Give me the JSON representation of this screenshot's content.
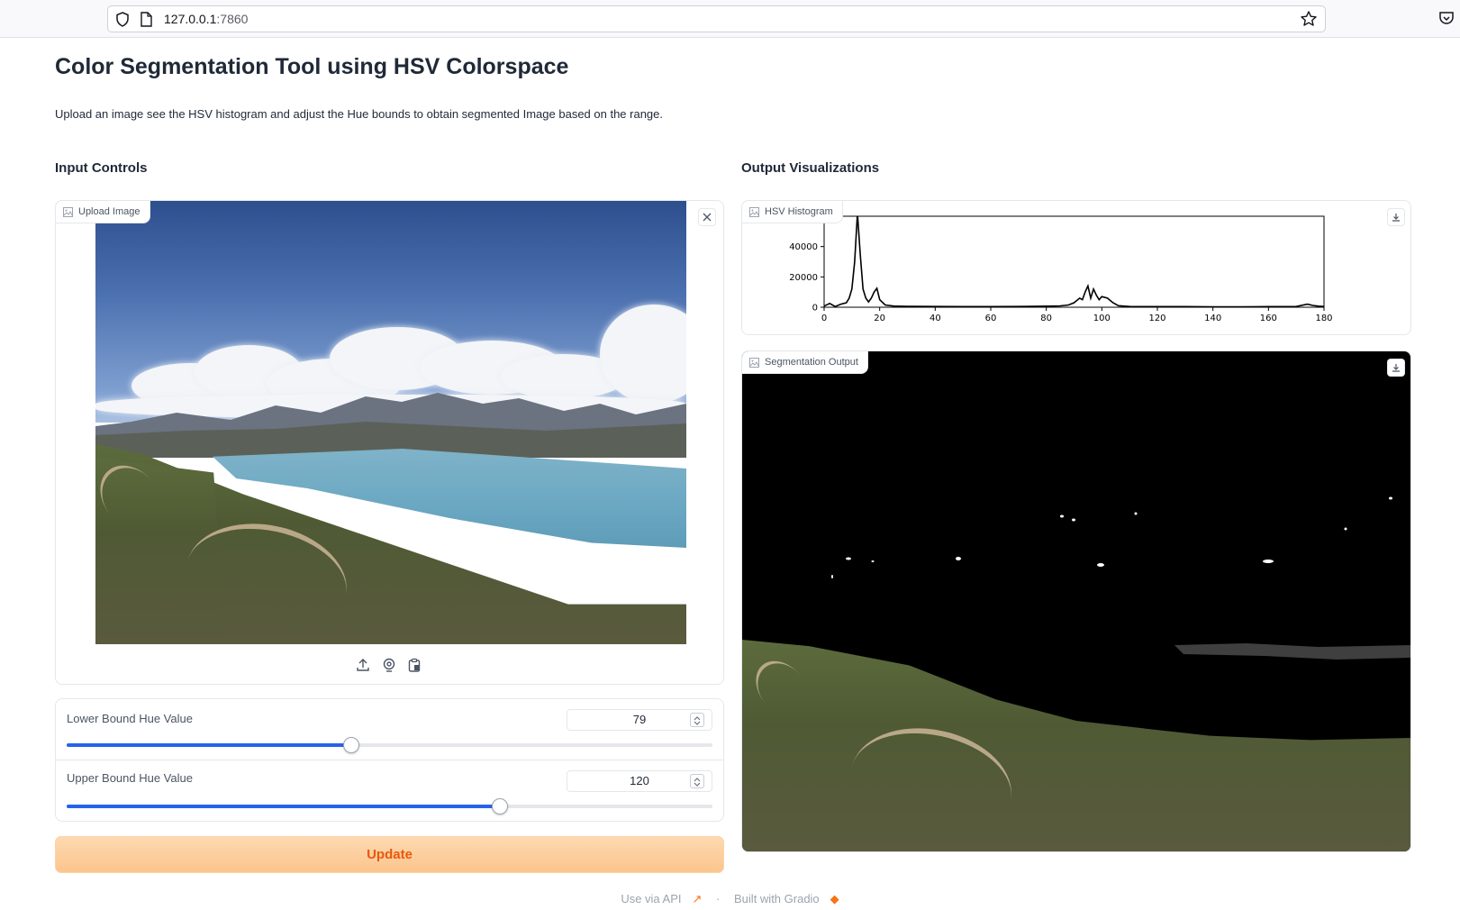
{
  "browser": {
    "url_host": "127.0.0.1",
    "url_port": ":7860"
  },
  "page": {
    "title": "Color Segmentation Tool using HSV Colorspace",
    "description": "Upload an image see the HSV histogram and adjust the Hue bounds to obtain segmented Image based on the range."
  },
  "input_controls": {
    "heading": "Input Controls",
    "upload_label": "Upload Image",
    "lower_bound": {
      "label": "Lower Bound Hue Value",
      "value": "79",
      "min": 0,
      "max": 179
    },
    "upper_bound": {
      "label": "Upper Bound Hue Value",
      "value": "120",
      "min": 0,
      "max": 179
    },
    "update_label": "Update"
  },
  "output": {
    "heading": "Output Visualizations",
    "histogram_label": "HSV Histogram",
    "segmentation_label": "Segmentation Output"
  },
  "footer": {
    "api_label": "Use via API",
    "separator": "·",
    "built_label": "Built with Gradio"
  },
  "colors": {
    "accent_blue": "#2563eb",
    "update_text": "#ea580c",
    "update_bg": "#fbc58d"
  },
  "chart_data": {
    "type": "line",
    "title": "",
    "xlabel": "",
    "ylabel": "",
    "xlim": [
      0,
      180
    ],
    "ylim": [
      0,
      60000
    ],
    "xticks": [
      "0",
      "20",
      "40",
      "60",
      "80",
      "100",
      "120",
      "140",
      "160",
      "180"
    ],
    "yticks": [
      "0",
      "20000",
      "40000",
      "60000"
    ],
    "series": [
      {
        "x": [
          0,
          2,
          4,
          6,
          8,
          9,
          10,
          11,
          12,
          13,
          14,
          15,
          16,
          17,
          18,
          19,
          20,
          22,
          25,
          30,
          40,
          50,
          60,
          70,
          80,
          85,
          88,
          90,
          92,
          93,
          94,
          95,
          96,
          97,
          98,
          99,
          100,
          102,
          104,
          106,
          110,
          120,
          130,
          140,
          150,
          160,
          170,
          174,
          176,
          178,
          180
        ],
        "y": [
          800,
          2500,
          500,
          2000,
          3000,
          6000,
          12000,
          30000,
          62000,
          35000,
          12000,
          6000,
          3500,
          6000,
          10000,
          12500,
          5000,
          1500,
          800,
          600,
          500,
          400,
          400,
          500,
          700,
          900,
          1500,
          3000,
          6000,
          5000,
          10000,
          14000,
          6000,
          12000,
          8000,
          5000,
          7000,
          6000,
          3000,
          1000,
          500,
          400,
          400,
          300,
          300,
          400,
          500,
          2000,
          1200,
          700,
          500
        ]
      }
    ]
  }
}
